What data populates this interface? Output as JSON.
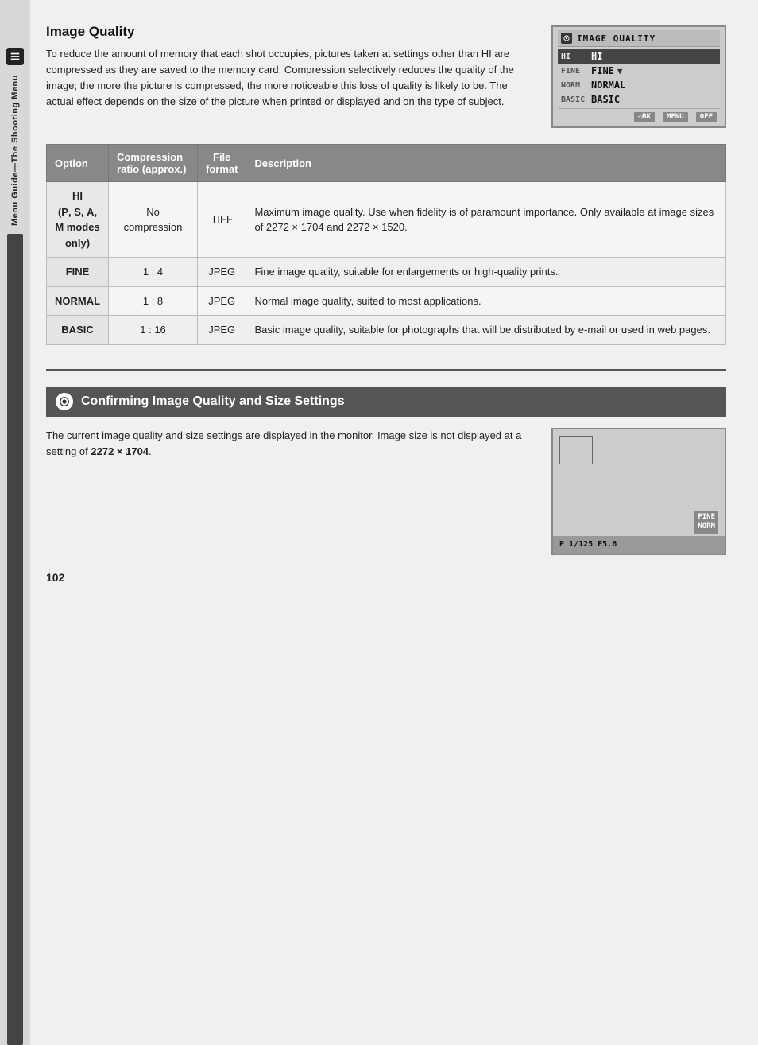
{
  "sidebar": {
    "icon_label": "menu-icon",
    "text": "Menu Guide—The Shooting Menu"
  },
  "image_quality_section": {
    "title": "Image Quality",
    "body": "To reduce the amount of memory that each shot occupies, pictures taken at settings other than HI are compressed as they are saved to the memory card.  Compression selectively reduces the quality of the image; the more the picture is compressed, the more noticeable this loss of quality is likely to be.  The actual effect depends on the size of the picture when printed or displayed and on the type of subject.",
    "screen": {
      "title": "IMAGE QUALITY",
      "items": [
        {
          "label": "HI",
          "value": "HI",
          "selected": false
        },
        {
          "label": "FINE",
          "value": "FINE",
          "selected": true
        },
        {
          "label": "NORM",
          "value": "NORMAL",
          "selected": false
        },
        {
          "label": "BASIC",
          "value": "BASIC",
          "selected": false
        }
      ],
      "footer_back": "◁BK",
      "footer_menu": "MENU",
      "footer_off": "OFF"
    }
  },
  "table": {
    "headers": [
      "Option",
      "Compression ratio (approx.)",
      "File format",
      "Description"
    ],
    "rows": [
      {
        "option": "HI\n(P, S, A,\nM modes\nonly)",
        "option_bold": true,
        "compression": "No compression",
        "format": "TIFF",
        "description": "Maximum image quality.  Use when fidelity is of paramount importance. Only available at image sizes of 2272 × 1704 and 2272 × 1520."
      },
      {
        "option": "FINE",
        "option_bold": true,
        "compression": "1 : 4",
        "format": "JPEG",
        "description": "Fine image quality, suitable for enlargements or high-quality prints."
      },
      {
        "option": "NORMAL",
        "option_bold": true,
        "compression": "1 : 8",
        "format": "JPEG",
        "description": "Normal image quality, suited to most applications."
      },
      {
        "option": "BASIC",
        "option_bold": true,
        "compression": "1 : 16",
        "format": "JPEG",
        "description": "Basic image quality, suitable for photographs that will be distributed by e-mail or used in web pages."
      }
    ]
  },
  "confirming_section": {
    "title": "Confirming Image Quality and Size Settings",
    "body": "The current image quality and size settings are displayed in the monitor.  Image size is not displayed at a setting of 2272 × 1704.",
    "bold_text": "2272 × 1704",
    "screen": {
      "bottom_values": "P   1/125  F5.6",
      "quality_badge_line1": "FINE",
      "quality_badge_line2": "NORM"
    }
  },
  "page": {
    "number": "102"
  }
}
